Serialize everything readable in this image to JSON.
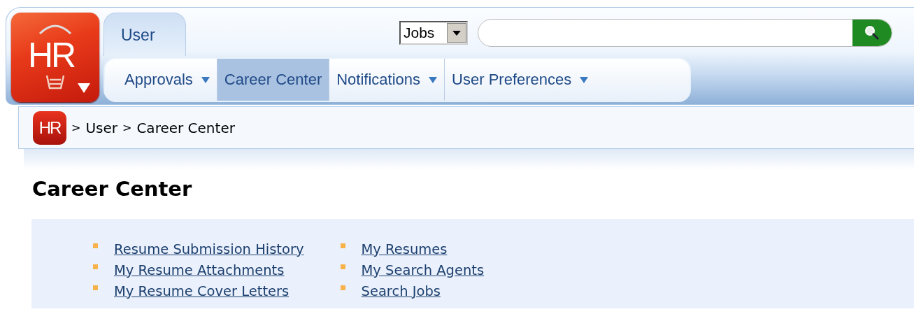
{
  "logo": {
    "text": "HR"
  },
  "tabs": [
    {
      "label": "User",
      "selected": true
    }
  ],
  "search": {
    "scope": "Jobs"
  },
  "nav": [
    {
      "label": "Approvals",
      "selected": false,
      "has_menu": true
    },
    {
      "label": "Career Center",
      "selected": true,
      "has_menu": false
    },
    {
      "label": "Notifications",
      "selected": false,
      "has_menu": true
    },
    {
      "label": "User Preferences",
      "selected": false,
      "has_menu": true
    }
  ],
  "breadcrumb": {
    "logo": "HR",
    "items": [
      {
        "separator": ">",
        "label": "User"
      },
      {
        "separator": ">",
        "label": "Career Center"
      }
    ]
  },
  "heading": "Career Center",
  "links": [
    [
      "Resume Submission History",
      "My Resume Attachments",
      "My Resume Cover Letters"
    ],
    [
      "My Resumes",
      "My Search Agents",
      "Search Jobs"
    ]
  ]
}
